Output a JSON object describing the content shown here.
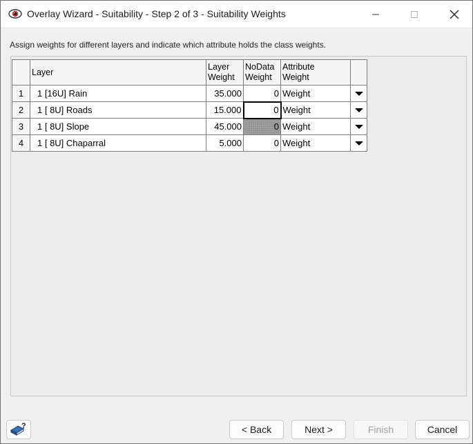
{
  "window": {
    "title": "Overlay Wizard - Suitability - Step 2 of 3 - Suitability Weights",
    "app_icon": "eye-icon"
  },
  "instruction": "Assign weights for different layers and indicate which attribute holds the class weights.",
  "table": {
    "headers": {
      "layer": "Layer",
      "layer_weight_1": "Layer",
      "layer_weight_2": "Weight",
      "nodata_1": "NoData",
      "nodata_2": "Weight",
      "attr_1": "Attribute",
      "attr_2": "Weight"
    },
    "rows": [
      {
        "num": "1",
        "layer": "1 [16U] Rain",
        "weight": "35.000",
        "nodata": "0",
        "attribute": "Weight"
      },
      {
        "num": "2",
        "layer": "1 [ 8U] Roads",
        "weight": "15.000",
        "nodata": "0",
        "attribute": "Weight"
      },
      {
        "num": "3",
        "layer": "1 [ 8U] Slope",
        "weight": "45.000",
        "nodata": "0",
        "attribute": "Weight"
      },
      {
        "num": "4",
        "layer": "1 [ 8U] Chaparral",
        "weight": "5.000",
        "nodata": "0",
        "attribute": "Weight"
      }
    ]
  },
  "buttons": {
    "back": "< Back",
    "next": "Next >",
    "finish": "Finish",
    "cancel": "Cancel"
  },
  "colors": {
    "window_bg": "#f0f0f0",
    "selected_border": "#000000",
    "grey_cell": "#a0a0a0",
    "disabled_text": "#a0a0a0"
  }
}
